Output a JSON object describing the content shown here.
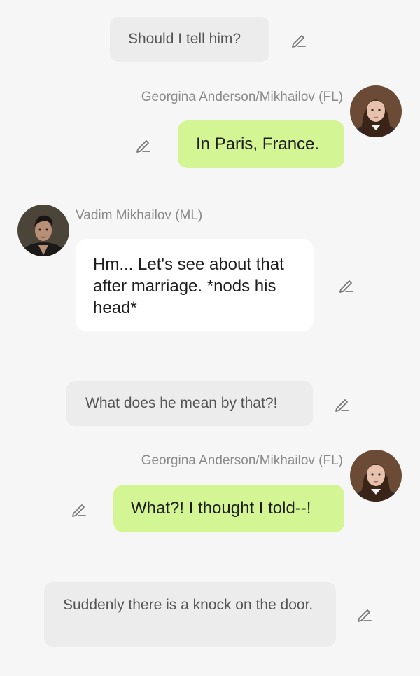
{
  "messages": [
    {
      "type": "narration",
      "text": "Should I tell him?"
    },
    {
      "type": "user",
      "sender": "Georgina Anderson/Mikhailov (FL)",
      "text": "In Paris, France."
    },
    {
      "type": "character",
      "sender": "Vadim Mikhailov (ML)",
      "text": "Hm... Let's see about that after marriage. *nods his head*"
    },
    {
      "type": "narration",
      "text": "What does he mean by that?!"
    },
    {
      "type": "user",
      "sender": "Georgina Anderson/Mikhailov (FL)",
      "text": "What?! I thought I told--!"
    },
    {
      "type": "narration",
      "text": "Suddenly there is a knock on the door."
    }
  ],
  "icons": {
    "edit": "pencil-edit-icon"
  },
  "colors": {
    "background": "#f6f6f6",
    "narration_bubble": "#ececec",
    "user_bubble": "#d4f593",
    "character_bubble": "#ffffff",
    "sender_name": "#8a8a8a"
  }
}
